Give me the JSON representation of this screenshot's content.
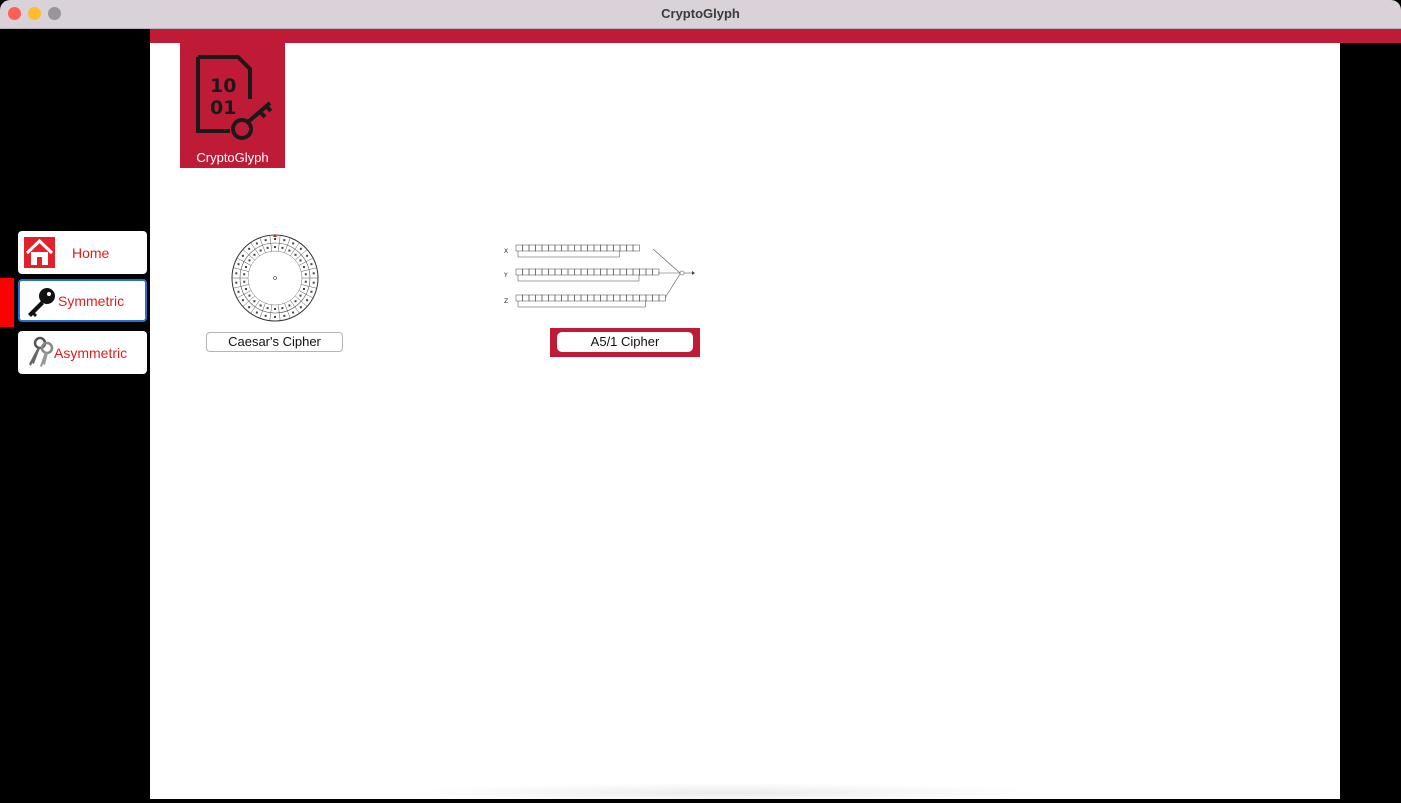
{
  "window": {
    "title": "CryptoGlyph"
  },
  "logo": {
    "digits_top": "10",
    "digits_bottom": "01",
    "name": "CryptoGlyph"
  },
  "sidebar": {
    "items": [
      {
        "label": "Home",
        "icon": "home-icon",
        "active": false
      },
      {
        "label": "Symmetric",
        "icon": "key-icon",
        "active": true
      },
      {
        "label": "Asymmetric",
        "icon": "keys-icon",
        "active": false
      }
    ]
  },
  "ciphers": [
    {
      "label": "Caesar's Cipher",
      "selected": false
    },
    {
      "label": "A5/1 Cipher",
      "selected": true
    }
  ],
  "a51_diagram": {
    "registers": [
      "X",
      "Y",
      "Z"
    ]
  },
  "colors": {
    "brand": "#c01b36",
    "nav_text": "#e31c1c",
    "focus": "#2a6fd1"
  }
}
